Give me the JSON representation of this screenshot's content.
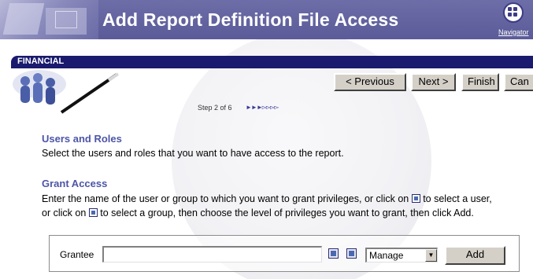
{
  "header": {
    "title": "Add Report Definition File Access",
    "navigator_label": "Navigator",
    "navigator_icon": "navigator-icon"
  },
  "wizard": {
    "section_label": "FINANCIAL",
    "buttons": {
      "previous": "< Previous",
      "next": "Next >",
      "finish": "Finish",
      "cancel": "Can"
    },
    "step_text": "Step 2 of 6",
    "step_progress": {
      "current": 2,
      "total": 6
    }
  },
  "users_roles": {
    "heading": "Users and Roles",
    "description": "Select the users and roles that you want to have access to the report."
  },
  "grant_access": {
    "heading": "Grant Access",
    "line1_before_icon": "Enter the name of the user or group to which you want to grant privileges, or click on",
    "line1_after_icon": "to select a user,",
    "line2_before_icon": "or click on",
    "line2_after_icon": "to select a group, then choose the level of privileges you want to grant, then click Add."
  },
  "grantee_form": {
    "label": "Grantee",
    "input_value": "",
    "privilege_selected": "Manage",
    "add_label": "Add",
    "select_user_icon": "user-lookup-icon",
    "select_group_icon": "group-lookup-icon"
  },
  "colors": {
    "banner": "#5b5b99",
    "section_bar": "#1a1a6e",
    "heading": "#4c55a6"
  }
}
